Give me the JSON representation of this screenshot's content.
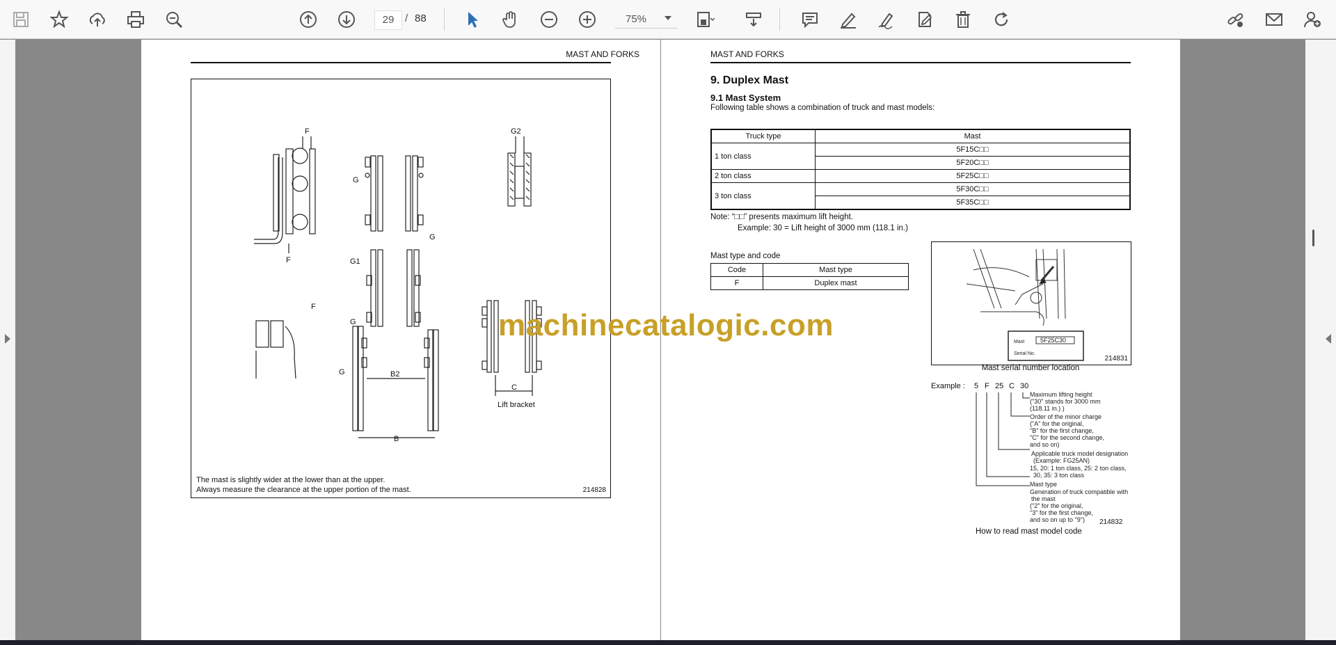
{
  "toolbar": {
    "current_page": "29",
    "page_separator": "/",
    "total_pages": "88",
    "zoom": "75%",
    "icons": [
      "save-icon",
      "bookmark-star-icon",
      "upload-icon",
      "print-icon",
      "zoom-out-magnifier-icon",
      "page-up-icon",
      "page-down-icon",
      "select-pointer-icon",
      "hand-pan-icon",
      "zoom-out-icon",
      "zoom-in-icon",
      "fit-page-icon",
      "page-layout-icon",
      "comment-icon",
      "highlight-pen-icon",
      "draw-icon",
      "sign-icon",
      "delete-icon",
      "rotate-icon",
      "share-link-icon",
      "email-icon",
      "add-user-icon"
    ],
    "accent_color": "#2c6fb7"
  },
  "left_page": {
    "running_head": "MAST AND FORKS",
    "figure": {
      "labels": [
        "F",
        "F",
        "G",
        "G",
        "G2",
        "G1",
        "G",
        "F",
        "G",
        "B2",
        "B",
        "C"
      ],
      "lift_bracket": "Lift bracket",
      "note_line1": "The mast is slightly wider at the lower than at the upper.",
      "note_line2": "Always measure the clearance at the upper portion of the mast.",
      "figure_number": "214828"
    }
  },
  "right_page": {
    "running_head": "MAST AND FORKS",
    "section_title": "9.  Duplex Mast",
    "subsection_title": "9.1    Mast System",
    "intro": "Following table shows a combination of truck and mast models:",
    "combo_table": {
      "headers": [
        "Truck type",
        "Mast"
      ],
      "rows": [
        {
          "truck": "1 ton class",
          "masts": [
            "5F15C□□",
            "5F20C□□"
          ]
        },
        {
          "truck": "2 ton class",
          "masts": [
            "5F25C□□"
          ]
        },
        {
          "truck": "3 ton class",
          "masts": [
            "5F30C□□",
            "5F35C□□"
          ]
        }
      ]
    },
    "note_line1": "Note:  “□□” presents maximum lift height.",
    "note_line2": "Example:  30 = Lift height of 3000 mm (118.1 in.)",
    "type_table_title": "Mast type and code",
    "type_table": {
      "headers": [
        "Code",
        "Mast type"
      ],
      "rows": [
        [
          "F",
          "Duplex mast"
        ]
      ]
    },
    "photo_caption": "Mast serial number location",
    "photo_number": "214831",
    "plate_text": "5F25C30",
    "plate_labels": [
      "Mast",
      "Serial No."
    ],
    "example_label": "Example :",
    "code_chars": [
      "5",
      "F",
      "25",
      "C",
      "30"
    ],
    "annotations": [
      "Maximum lifting height",
      "(\"30\" stands for 3000 mm",
      "(118.11 in.) )",
      "Order of the minor charge",
      "(\"A\" for the original,",
      "\"B\" for the first change,",
      "\"C\" for the second change,",
      "and so on)",
      "Applicable truck model designation",
      "(Example: FG25AN)",
      "15, 20: 1 ton class, 25: 2 ton class,",
      "30, 35: 3 ton class",
      "Mast type",
      "Generation of truck compatible with",
      "the mast",
      "(\"2\" for the original,",
      "\"3\" for the first change,",
      "and so on up to \"9\")"
    ],
    "code_fig_number": "214832",
    "code_caption": "How to read mast model code"
  },
  "watermark": "machinecatalogic.com"
}
